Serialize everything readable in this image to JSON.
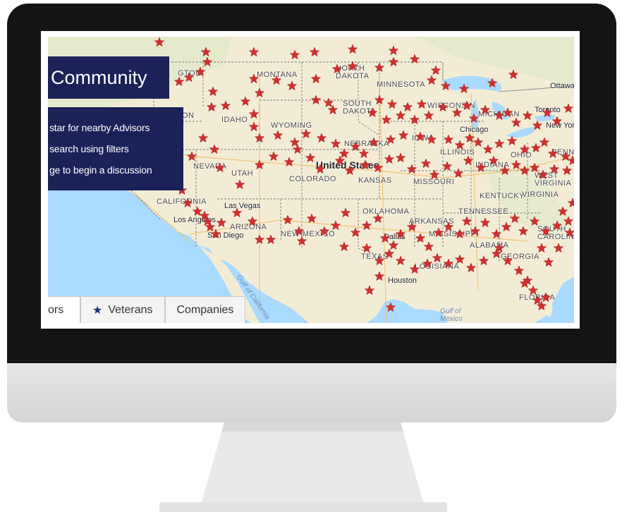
{
  "panel": {
    "title": "Community",
    "instructions": [
      "star for nearby Advisors",
      "search using filters",
      "ge to begin a discussion"
    ]
  },
  "tabs": [
    {
      "label": "ors",
      "icon": "none"
    },
    {
      "label": "Veterans",
      "icon": "star-icon"
    },
    {
      "label": "Companies",
      "icon": "none"
    }
  ],
  "map": {
    "country_label": "United States",
    "state_labels": [
      "MONTANA",
      "NORTH DAKOTA",
      "MINNESOTA",
      "SOUTH DAKOTA",
      "WISCONSIN",
      "MICHIGAN",
      "IDAHO",
      "WYOMING",
      "NEBRASKA",
      "IOWA",
      "ILLINOIS",
      "OHIO",
      "PENN",
      "NEVADA",
      "UTAH",
      "COLORADO",
      "KANSAS",
      "MISSOURI",
      "KENTUCKY",
      "VIRGINIA",
      "WEST VIRGINIA",
      "CALIFORNIA",
      "ARIZONA",
      "NEW MEXICO",
      "OKLAHOMA",
      "ARKANSAS",
      "TENNESSEE",
      "MISSISSIPPI",
      "ALABAMA",
      "GEORGIA",
      "SOUTH CAROLINA",
      "TEXAS",
      "LOUISIANA",
      "FLORIDA",
      "INDIANA"
    ],
    "city_labels": [
      "Las Vegas",
      "Los Angeles",
      "San Diego",
      "Dallas",
      "Houston",
      "Chicago",
      "Toronto",
      "Ottawa",
      "New York"
    ],
    "water_labels": [
      "Gulf of California",
      "Gulf of Mexico"
    ],
    "partial_labels": [
      "GTON",
      "ON",
      "NEW"
    ],
    "land_color": "#f3ecd5",
    "water_color": "#aadaff",
    "marker_color": "#d32f2f",
    "marker_icon": "star-marker-icon"
  },
  "device": {
    "bezel_color": "#141414",
    "chin_color": "#dcdcdc"
  }
}
